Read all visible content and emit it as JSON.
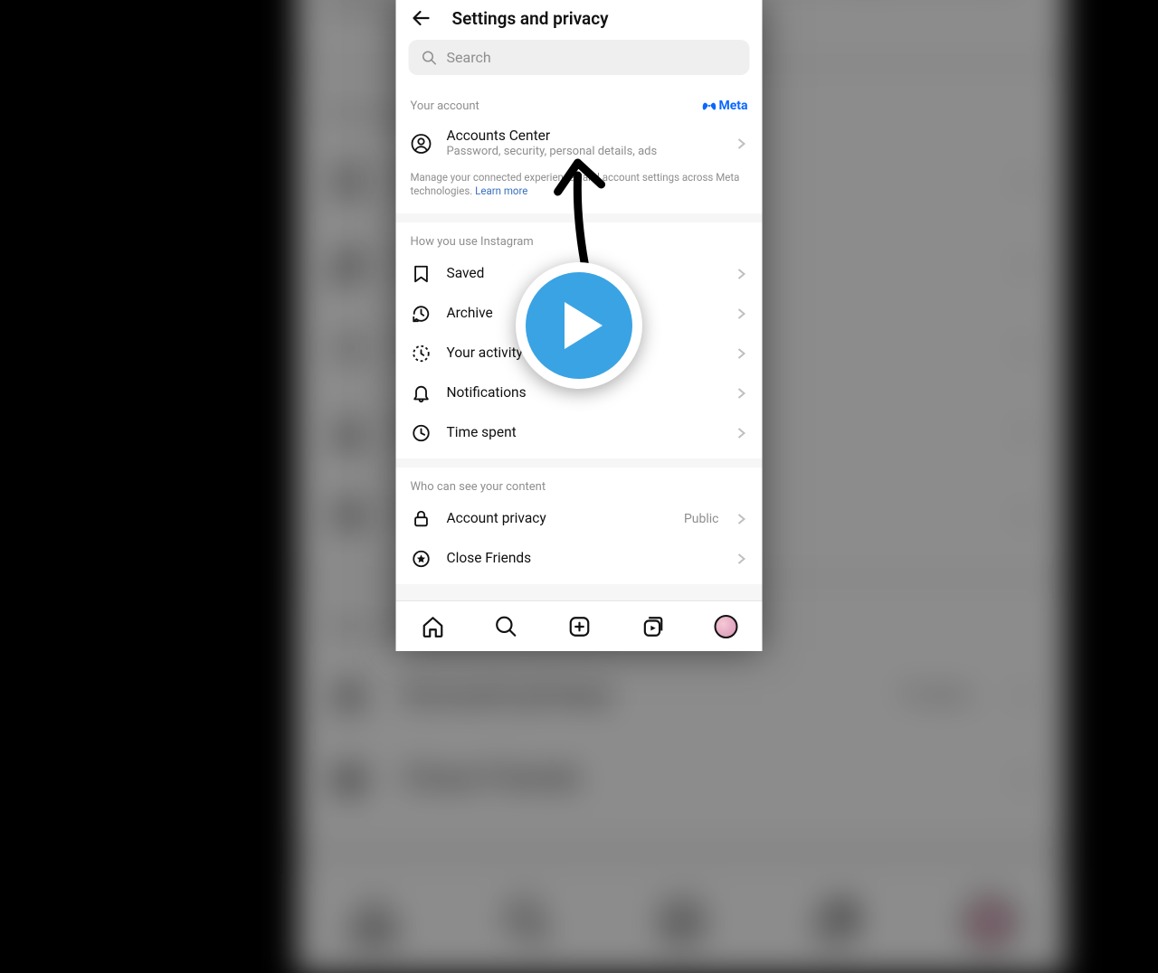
{
  "header": {
    "title": "Settings and privacy"
  },
  "search": {
    "placeholder": "Search"
  },
  "section_account": {
    "label": "Your account",
    "brand": "Meta",
    "row": {
      "name": "Accounts Center",
      "sub": "Password, security, personal details, ads"
    },
    "footnote_a": "Manage your connected experiences and account settings across Meta technologies.",
    "footnote_learn": "Learn more"
  },
  "section_usage": {
    "label": "How you use Instagram",
    "items": [
      {
        "name": "Saved"
      },
      {
        "name": "Archive"
      },
      {
        "name": "Your activity"
      },
      {
        "name": "Notifications"
      },
      {
        "name": "Time spent"
      }
    ]
  },
  "section_visibility": {
    "label": "Who can see your content",
    "items": [
      {
        "name": "Account privacy",
        "value": "Public"
      },
      {
        "name": "Close Friends"
      }
    ]
  }
}
